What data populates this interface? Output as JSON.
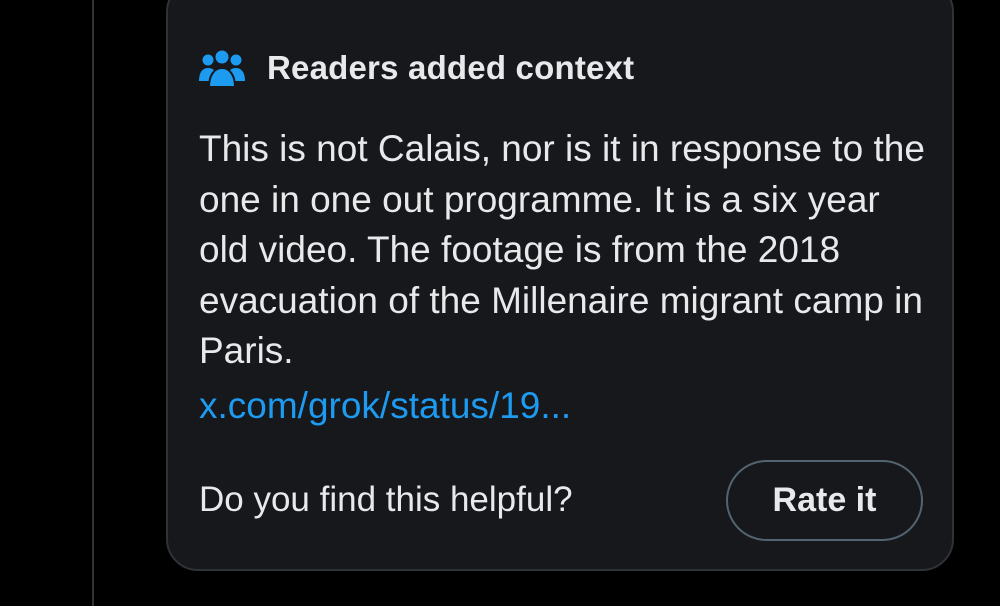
{
  "note": {
    "title": "Readers added context",
    "icon": "community-people-icon",
    "body": "This is not Calais, nor is it in response to the one in one out programme. It is a six year old video. The footage is from the 2018 evacuation of the Millenaire migrant camp in Paris.",
    "link_text": "x.com/grok/status/19..."
  },
  "feedback": {
    "question": "Do you find this helpful?",
    "rate_button_label": "Rate it"
  },
  "colors": {
    "background": "#000000",
    "card_background": "#16181c",
    "card_border": "#2f3336",
    "text_primary": "#e7e9ea",
    "accent_blue": "#1d9bf0",
    "button_border": "#536471"
  }
}
